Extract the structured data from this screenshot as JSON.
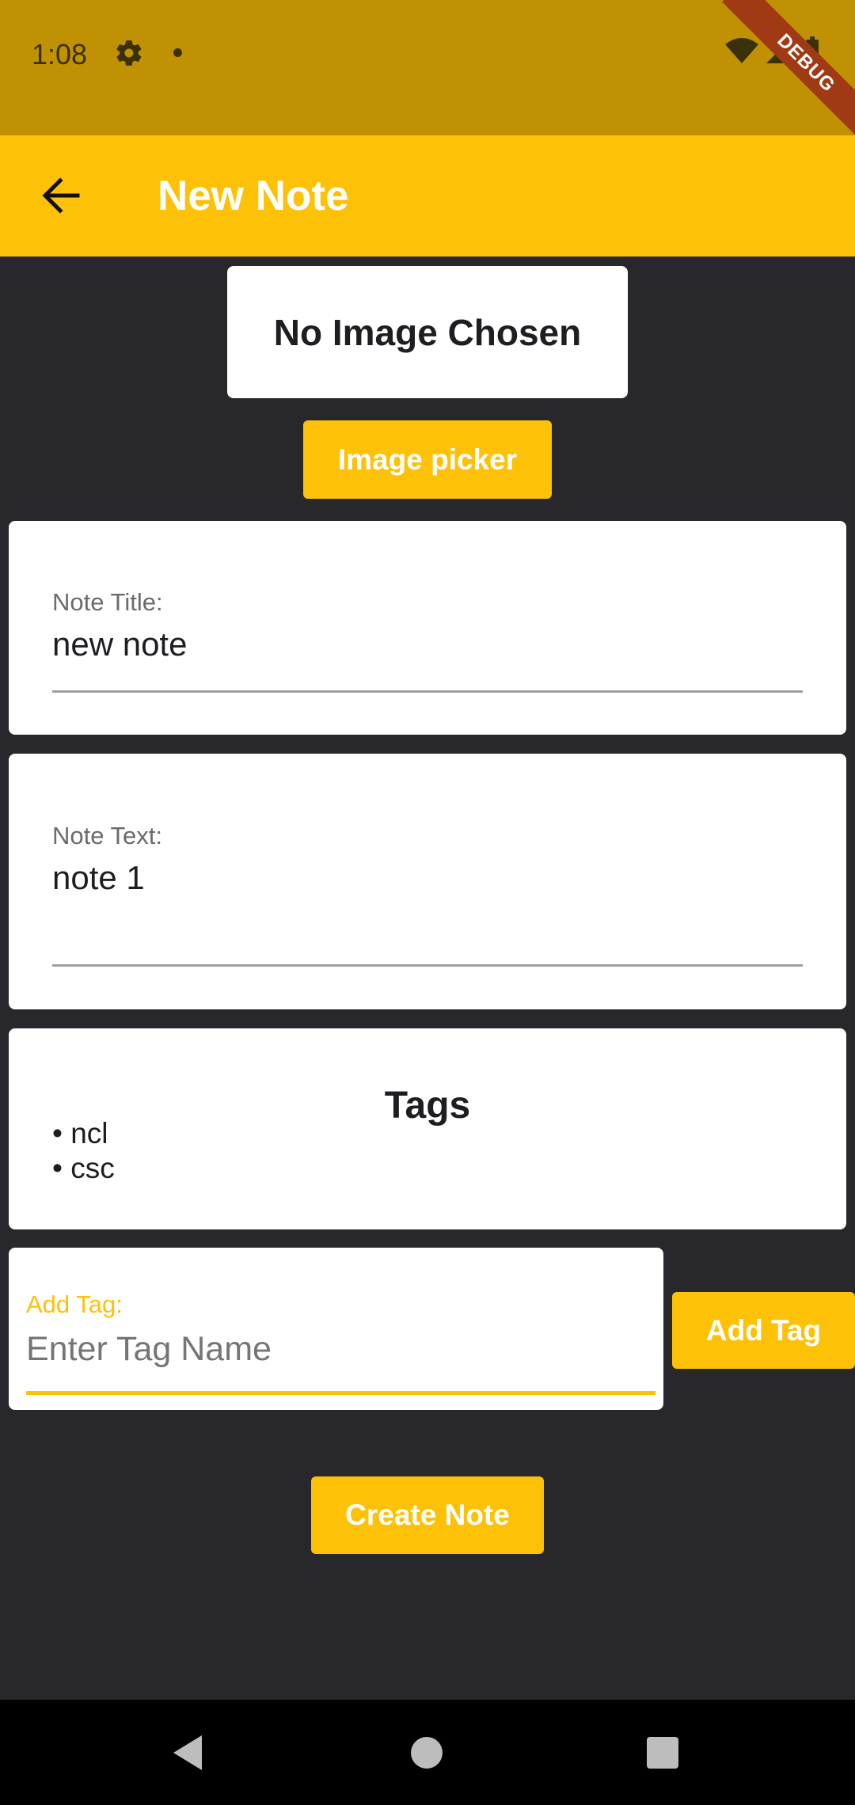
{
  "status_bar": {
    "time": "1:08",
    "icons": [
      "gear-icon",
      "notification-dot-icon",
      "wifi-icon",
      "signal-icon",
      "battery-icon"
    ],
    "debug_label": "DEBUG"
  },
  "app_bar": {
    "back_icon": "arrow-left-icon",
    "title": "New Note"
  },
  "image_section": {
    "status_text": "No Image Chosen",
    "picker_button": "Image picker"
  },
  "note_title": {
    "label": "Note Title:",
    "value": "new note"
  },
  "note_text": {
    "label": "Note Text:",
    "value": "note 1"
  },
  "tags": {
    "title": "Tags",
    "items": [
      "• ncl",
      "• csc"
    ]
  },
  "add_tag": {
    "label": "Add Tag:",
    "placeholder": "Enter Tag Name",
    "value": "",
    "button": "Add Tag"
  },
  "create_button": "Create Note",
  "nav_bar": {
    "icons": [
      "nav-back-icon",
      "nav-home-icon",
      "nav-recents-icon"
    ]
  },
  "colors": {
    "accent": "#fdc107",
    "status_bar": "#c09103",
    "background": "#28272c",
    "card": "#ffffff"
  }
}
